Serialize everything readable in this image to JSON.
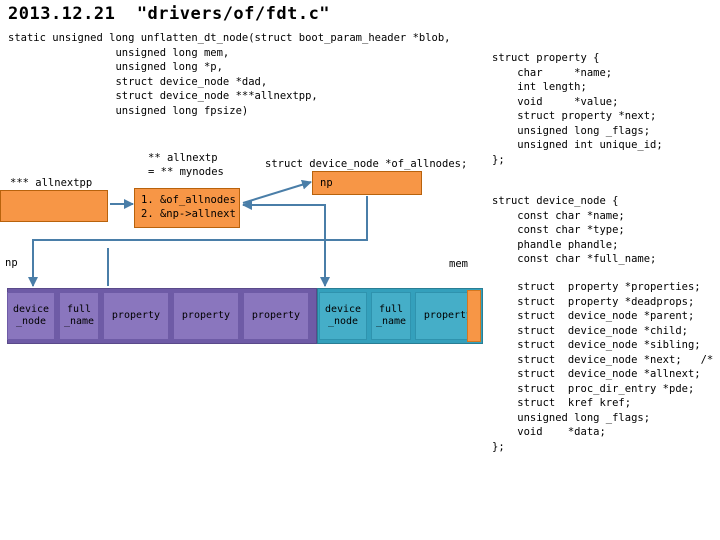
{
  "title": "2013.12.21  \"drivers/of/fdt.c\"",
  "code": {
    "signature": "static unsigned long unflatten_dt_node(struct boot_param_header *blob,\n                 unsigned long mem,\n                 unsigned long *p,\n                 struct device_node *dad,\n                 struct device_node ***allnextpp,\n                 unsigned long fpsize)",
    "struct_property": "struct property {\n    char     *name;\n    int length;\n    void     *value;\n    struct property *next;\n    unsigned long _flags;\n    unsigned int unique_id;\n};",
    "struct_device_node_head": "struct device_node {\n    const char *name;\n    const char *type;\n    phandle phandle;\n    const char *full_name;",
    "struct_device_node_fields": "    struct  property *properties;\n    struct  property *deadprops;\n    struct  device_node *parent;\n    struct  device_node *child;\n    struct  device_node *sibling;\n    struct  device_node *next;   /*\n    struct  device_node *allnext;\n    struct  proc_dir_entry *pde;\n    struct  kref kref;\n    unsigned long _flags;\n    void    *data;\n};",
    "of_allnodes_decl": "struct device_node *of_allnodes;"
  },
  "labels": {
    "allnextp": "** allnextp\n= ** mynodes",
    "allnextpp": "*** allnextpp",
    "np_left": "np",
    "mem": "mem"
  },
  "boxes": {
    "allnextpp_box": "",
    "steps": "1. &of_allnodes\n2. &np->allnext",
    "np": "np"
  },
  "memory_strip": {
    "groups": [
      {
        "name": "first-node-group",
        "color": "#6E5BA6",
        "cells": [
          {
            "label": "device\n_node",
            "kind": "purple"
          },
          {
            "label": "full\n_name",
            "kind": "purple"
          },
          {
            "label": "property",
            "kind": "purple"
          },
          {
            "label": "property",
            "kind": "purple"
          },
          {
            "label": "property",
            "kind": "purple"
          }
        ]
      },
      {
        "name": "second-node-group",
        "color": "#34A0BC",
        "cells": [
          {
            "label": "device\n_node",
            "kind": "teal"
          },
          {
            "label": "full\n_name",
            "kind": "teal"
          },
          {
            "label": "property",
            "kind": "teal"
          },
          {
            "label": "",
            "kind": "orange"
          }
        ]
      }
    ]
  },
  "colors": {
    "orange_fill": "#F79646",
    "orange_stroke": "#B8620C",
    "purple_group": "#6E5BA6",
    "purple_cell": "#8A76BE",
    "teal_group": "#34A0BC",
    "teal_cell": "#45AEC8",
    "wire": "#4A7EA8"
  }
}
